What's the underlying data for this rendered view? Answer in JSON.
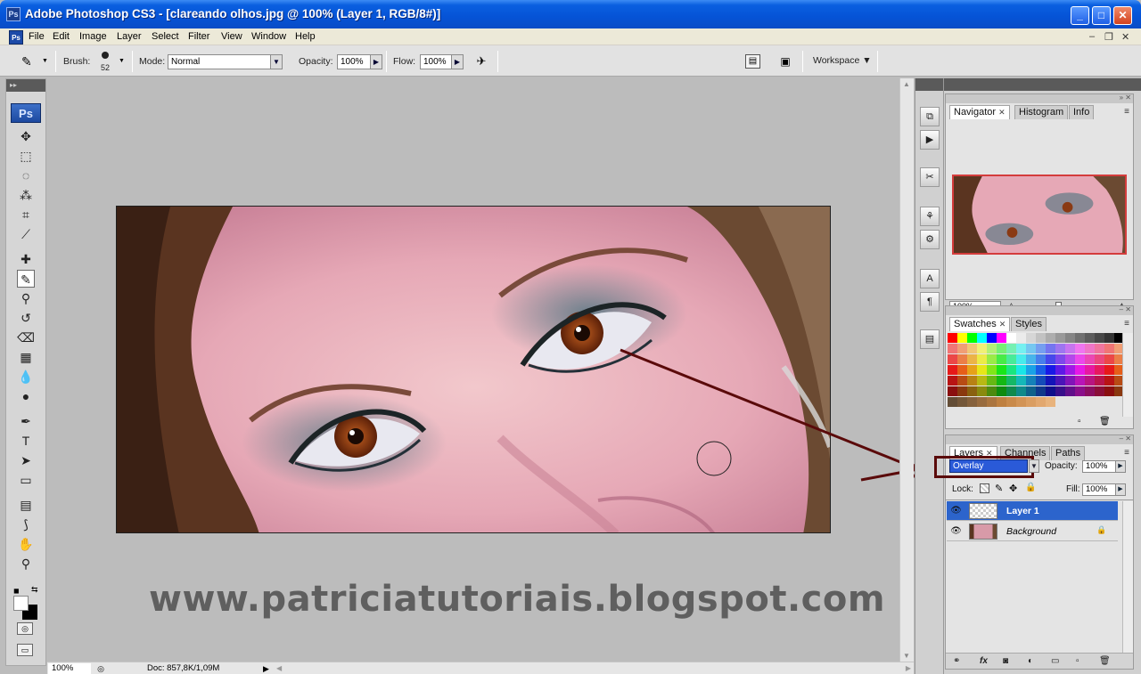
{
  "window": {
    "title": "Adobe Photoshop CS3 - [clareando olhos.jpg @ 100% (Layer 1, RGB/8#)]",
    "app_icon_text": "Ps",
    "controls": {
      "minimize": "_",
      "maximize": "□",
      "close": "✕"
    }
  },
  "menubar": {
    "items": [
      "File",
      "Edit",
      "Image",
      "Layer",
      "Select",
      "Filter",
      "View",
      "Window",
      "Help"
    ],
    "doc_controls": {
      "minimize": "–",
      "restore": "❐",
      "close": "✕"
    }
  },
  "options": {
    "brush_label": "Brush:",
    "brush_size": "52",
    "mode_label": "Mode:",
    "mode_value": "Normal",
    "opacity_label": "Opacity:",
    "opacity_value": "100%",
    "flow_label": "Flow:",
    "flow_value": "100%",
    "workspace_label": "Workspace ▼"
  },
  "toolbox": {
    "ps_label": "Ps",
    "tools": [
      {
        "name": "move-tool",
        "glyph": "✥"
      },
      {
        "name": "marquee-tool",
        "glyph": "⬚"
      },
      {
        "name": "lasso-tool",
        "glyph": "◌"
      },
      {
        "name": "magic-wand-tool",
        "glyph": "⁂"
      },
      {
        "name": "crop-tool",
        "glyph": "⌗"
      },
      {
        "name": "slice-tool",
        "glyph": "⟋"
      },
      {
        "name": "healing-brush-tool",
        "glyph": "✚"
      },
      {
        "name": "brush-tool",
        "glyph": "✎"
      },
      {
        "name": "clone-stamp-tool",
        "glyph": "⚲"
      },
      {
        "name": "history-brush-tool",
        "glyph": "↺"
      },
      {
        "name": "eraser-tool",
        "glyph": "⌫"
      },
      {
        "name": "gradient-tool",
        "glyph": "▦"
      },
      {
        "name": "blur-tool",
        "glyph": "💧"
      },
      {
        "name": "dodge-tool",
        "glyph": "●"
      },
      {
        "name": "pen-tool",
        "glyph": "✒"
      },
      {
        "name": "type-tool",
        "glyph": "T"
      },
      {
        "name": "path-selection-tool",
        "glyph": "➤"
      },
      {
        "name": "rectangle-tool",
        "glyph": "▭"
      },
      {
        "name": "notes-tool",
        "glyph": "▤"
      },
      {
        "name": "eyedropper-tool",
        "glyph": "⟆"
      },
      {
        "name": "hand-tool",
        "glyph": "✋"
      },
      {
        "name": "zoom-tool",
        "glyph": "⚲"
      }
    ]
  },
  "document": {
    "watermark": "www.patriciatutoriais.blogspot.com"
  },
  "statusbar": {
    "zoom": "100%",
    "doc_info": "Doc: 857,8K/1,09M"
  },
  "navigator": {
    "tabs": [
      "Navigator",
      "Histogram",
      "Info"
    ],
    "zoom": "100%"
  },
  "swatches": {
    "tabs": [
      "Swatches",
      "Styles"
    ]
  },
  "layers": {
    "tabs": [
      "Layers",
      "Channels",
      "Paths"
    ],
    "blend_mode": "Overlay",
    "opacity_label": "Opacity:",
    "opacity_value": "100%",
    "lock_label": "Lock:",
    "fill_label": "Fill:",
    "fill_value": "100%",
    "rows": [
      {
        "name": "Layer 1",
        "selected": true
      },
      {
        "name": "Background",
        "selected": false
      }
    ]
  },
  "colors": {
    "title_bar": "#0553d6",
    "menubar_bg": "#ece9d8",
    "canvas_bg": "#bcbcbc",
    "selection_blue": "#2c64cc",
    "annotation_arrow": "#5a0a0a"
  }
}
